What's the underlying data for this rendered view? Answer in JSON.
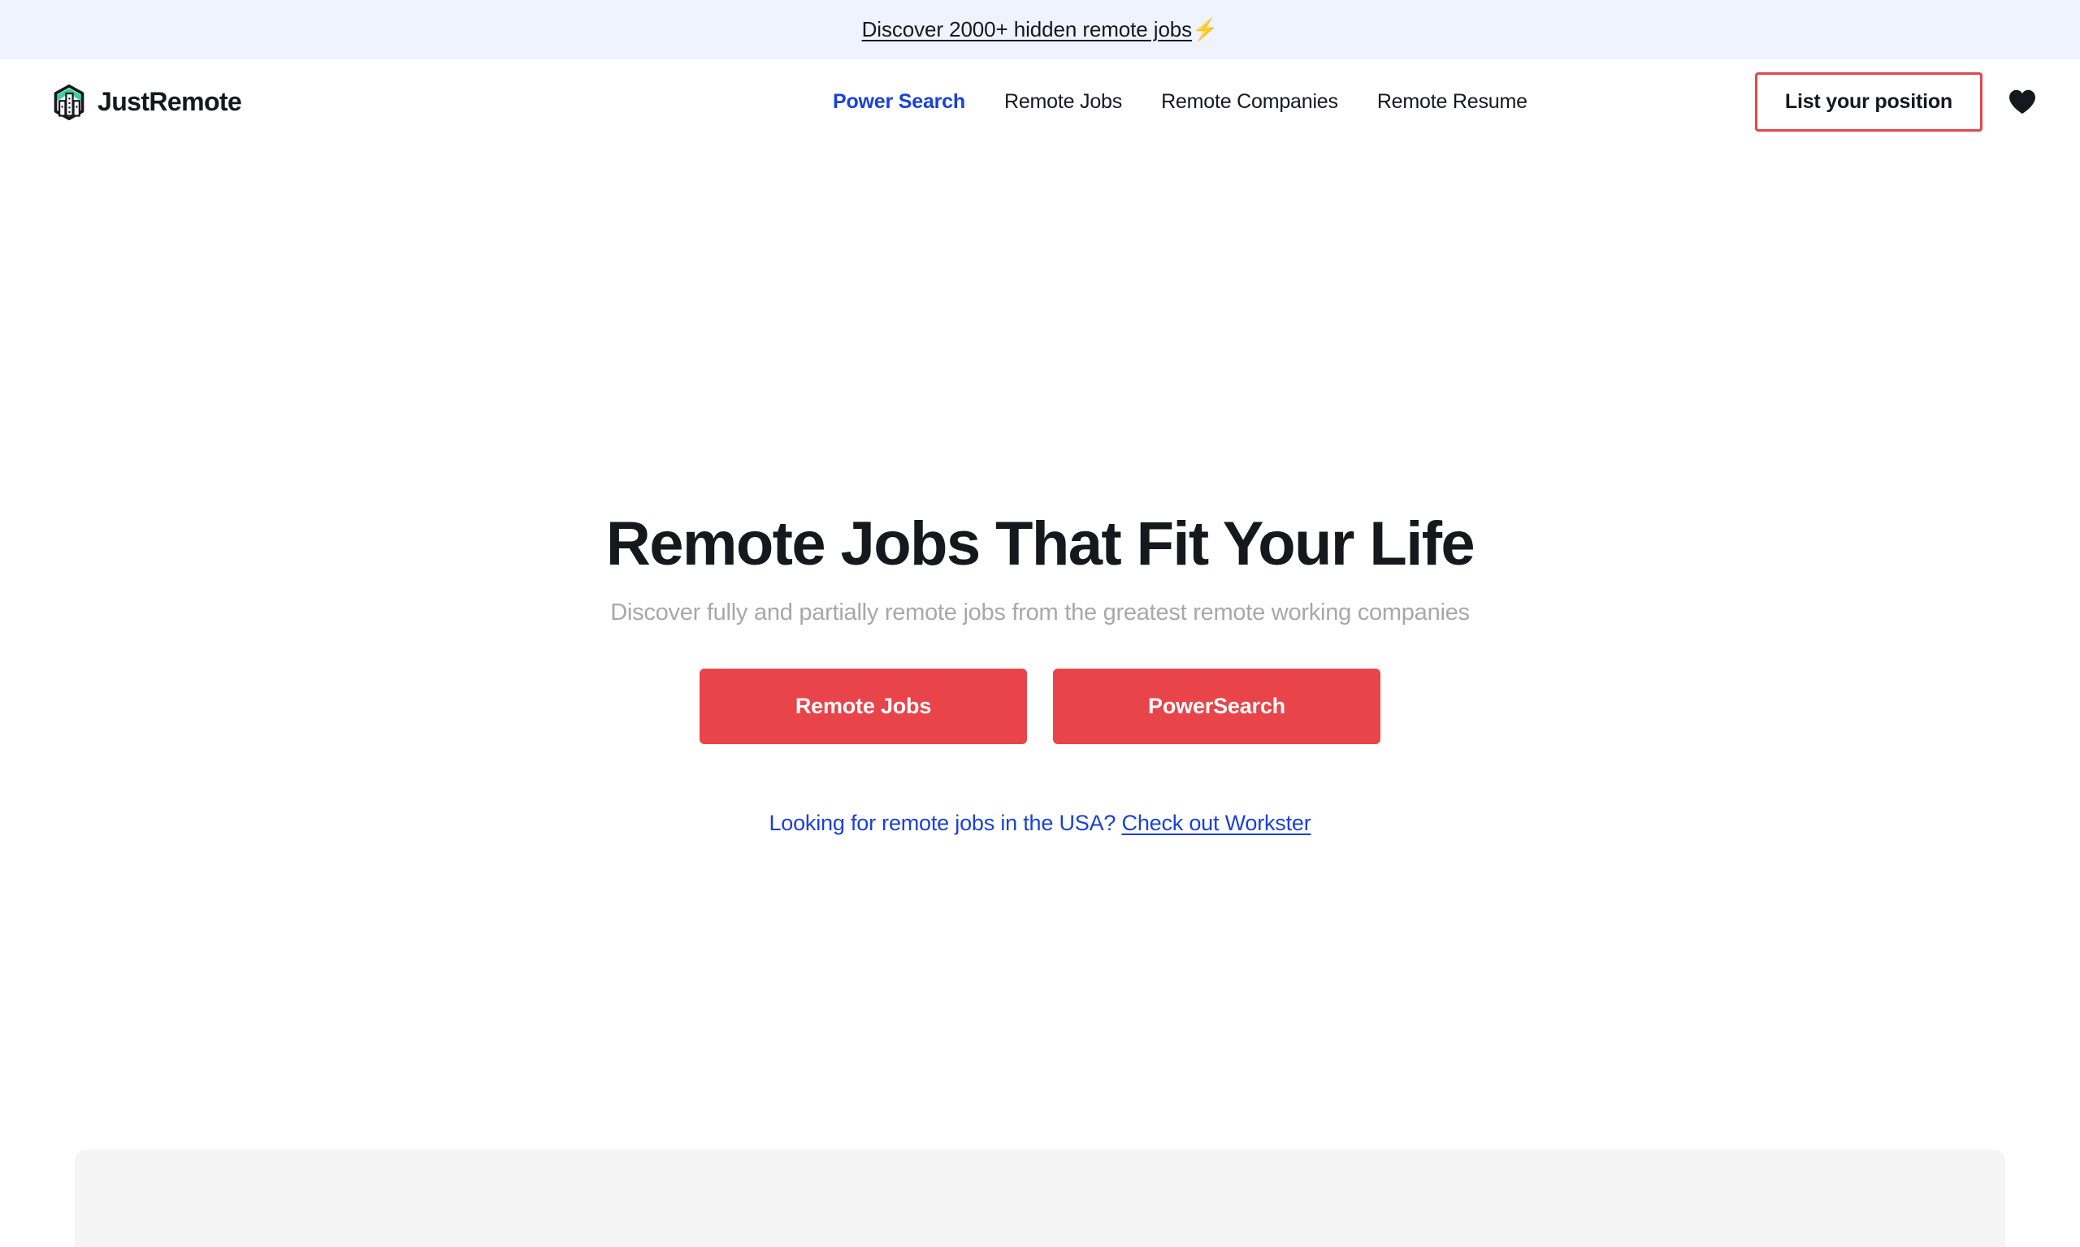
{
  "promo": {
    "text": "Discover 2000+ hidden remote jobs",
    "emoji": "⚡",
    "background": "#eff3fe"
  },
  "header": {
    "brand_name": "JustRemote",
    "logo_icon": "hexagon-buildings-logo-icon",
    "nav": [
      {
        "label": "Power Search",
        "active": true
      },
      {
        "label": "Remote Jobs",
        "active": false
      },
      {
        "label": "Remote Companies",
        "active": false
      },
      {
        "label": "Remote Resume",
        "active": false
      }
    ],
    "list_position_label": "List your position",
    "favorites_icon": "heart-icon",
    "accent_blue": "#1a41d8",
    "accent_red": "#e0474d"
  },
  "hero": {
    "title": "Remote Jobs That Fit Your Life",
    "subtitle": "Discover fully and partially remote jobs from the greatest remote working companies",
    "primary_cta": "Remote Jobs",
    "secondary_cta": "PowerSearch",
    "note_text": "Looking for remote jobs in the USA?",
    "note_link": "Check out Workster",
    "button_color": "#e8444a",
    "link_color": "#1a41d8"
  }
}
